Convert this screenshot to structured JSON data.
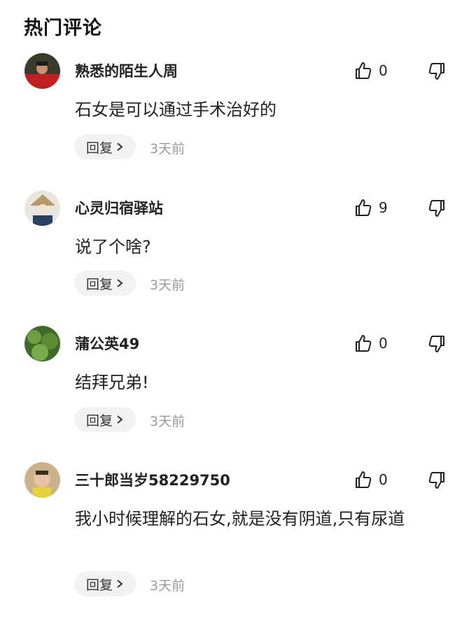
{
  "section": {
    "title": "热门评论"
  },
  "reply_label": "回复",
  "comments": [
    {
      "username": "熟悉的陌生人周",
      "likes": "0",
      "text": "石女是可以通过手术治好的",
      "time": "3天前"
    },
    {
      "username": "心灵归宿驿站",
      "likes": "9",
      "text": "说了个啥?",
      "time": "3天前"
    },
    {
      "username": "蒲公英49",
      "likes": "0",
      "text": "结拜兄弟!",
      "time": "3天前"
    },
    {
      "username": "三十郎当岁58229750",
      "likes": "0",
      "text": "我小时候理解的石女,就是没有阴道,只有尿道",
      "time": "3天前"
    }
  ]
}
